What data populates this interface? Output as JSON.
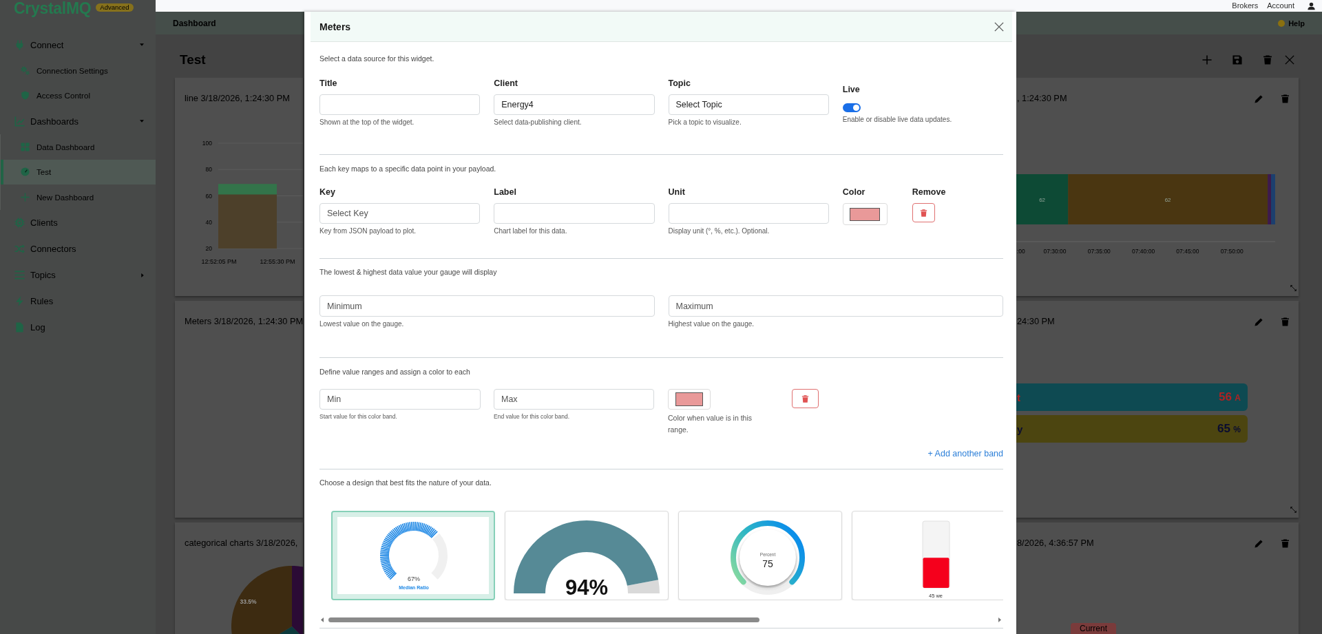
{
  "topbar": {
    "links": [
      "Brokers",
      "Account"
    ]
  },
  "sidebar": {
    "logo": "CrystalMQ",
    "badge": "Advanced",
    "items": [
      {
        "label": "Connect",
        "selected": false,
        "expanded": true,
        "children": [
          {
            "label": "Connection Settings",
            "selected": false
          },
          {
            "label": "Access Control",
            "selected": false
          }
        ]
      },
      {
        "label": "Dashboards",
        "selected": false,
        "expanded": true,
        "children": [
          {
            "label": "Data Dashboard",
            "selected": false
          },
          {
            "label": "Test",
            "selected": true
          },
          {
            "label": "New Dashboard",
            "selected": false
          }
        ]
      },
      {
        "label": "Clients",
        "selected": false
      },
      {
        "label": "Connectors",
        "selected": false
      },
      {
        "label": "Topics",
        "selected": false,
        "expanded": false
      },
      {
        "label": "Rules",
        "selected": false
      },
      {
        "label": "Log",
        "selected": false
      }
    ]
  },
  "header": {
    "title": "Dashboard",
    "help": "Help"
  },
  "dashboard": {
    "title": "Test",
    "left_widgets": [
      {
        "kind": "line",
        "title": "line 3/18/2026, 1:24:30 PM",
        "chart_data": {
          "type": "area",
          "x": [
            "12:52:05 PM",
            "12:55:30 PM"
          ],
          "ylim": [
            20,
            100
          ],
          "yticks": [
            20,
            40,
            60,
            80,
            100
          ],
          "grid": true,
          "series": [
            {
              "color": "#33744a",
              "values": [
                69,
                69
              ]
            },
            {
              "color": "#4d402a",
              "values": [
                61,
                61
              ]
            }
          ]
        }
      },
      {
        "kind": "meters",
        "title": "Meters 3/18/2026, 1:24:30 PM"
      },
      {
        "kind": "pie",
        "title": "categorical charts 3/18/2026,",
        "slices": [
          {
            "color": "#2b0b35"
          },
          {
            "color": "#0c3a3c"
          },
          {
            "color": "#3d2b11",
            "label": "33.5%"
          }
        ]
      }
    ],
    "right_widgets": [
      {
        "kind": "timeline",
        "title": ", 1:24:30 PM",
        "segments": [
          {
            "color": "#0d4a35",
            "label": "62"
          },
          {
            "color": "#4a3611",
            "label": "62"
          },
          {
            "color": "#3e1a4c"
          },
          {
            "color": "#1c3f6e"
          }
        ],
        "ticks": [
          ":00",
          "07:30:00",
          "07:35:00",
          "07:40:00",
          "07:45:00",
          "07:50:00"
        ]
      },
      {
        "kind": "meters",
        "title": "24:30 PM",
        "bars": [
          {
            "color": "#0e4a52",
            "label": "t",
            "reading": {
              "value": "56",
              "unit": "A",
              "color": "#b02222"
            }
          },
          {
            "color": "#4c4510",
            "label": "y",
            "reading": {
              "value": "65",
              "unit": "%",
              "color": "#0a0c30"
            }
          }
        ]
      },
      {
        "kind": "button",
        "title": "8/2026, 4:36:57 PM",
        "button": "Current"
      }
    ]
  },
  "modal": {
    "title": "Meters",
    "source": {
      "intro": "Select a data source for this widget.",
      "fields": [
        {
          "kind": "input",
          "label": "Title",
          "hint": "Shown at the top of the widget."
        },
        {
          "kind": "select",
          "label": "Client",
          "value": "Energy4",
          "hint": "Select data-publishing client."
        },
        {
          "kind": "select",
          "label": "Topic",
          "value": "Select Topic",
          "hint": "Pick a topic to visualize."
        },
        {
          "kind": "toggle",
          "label": "Live",
          "on": true,
          "hint": "Enable or disable live data updates."
        }
      ]
    },
    "keys": {
      "intro": "Each key maps to a specific data point in your payload.",
      "fields": [
        {
          "kind": "input",
          "label": "Key",
          "placeholder": "Select Key",
          "hint": "Key from JSON payload to plot."
        },
        {
          "kind": "input",
          "label": "Label",
          "hint": "Chart label for this data."
        },
        {
          "kind": "input",
          "label": "Unit",
          "hint": "Display unit (°, %, etc.). Optional."
        },
        {
          "kind": "color",
          "label": "Color",
          "color": "#e99999"
        },
        {
          "kind": "remove",
          "label": "Remove"
        }
      ]
    },
    "range": {
      "intro": "The lowest & highest data value your gauge will display",
      "fields": [
        {
          "placeholder": "Minimum",
          "hint": "Lowest value on the gauge."
        },
        {
          "placeholder": "Maximum",
          "hint": "Highest value on the gauge."
        }
      ]
    },
    "bands": {
      "intro": "Define value ranges and assign a color to each",
      "items": [
        {
          "min": {
            "placeholder": "Min",
            "hint": "Start value for this color band."
          },
          "max": {
            "placeholder": "Max",
            "hint": "End value for this color band."
          },
          "color": "#e99999",
          "color_hint": "Color when value is in this range."
        }
      ],
      "add": "+ Add another band"
    },
    "designs": {
      "intro": "Choose a design that best fits the nature of your data.",
      "items": [
        {
          "kind": "ticks",
          "selected": true,
          "value": "67%",
          "caption": "Median Ratio"
        },
        {
          "kind": "half",
          "selected": false,
          "value": "94%"
        },
        {
          "kind": "ring",
          "selected": false,
          "caption": "Percent",
          "value": "75"
        },
        {
          "kind": "tank",
          "selected": false,
          "value": "45 we"
        }
      ]
    }
  }
}
